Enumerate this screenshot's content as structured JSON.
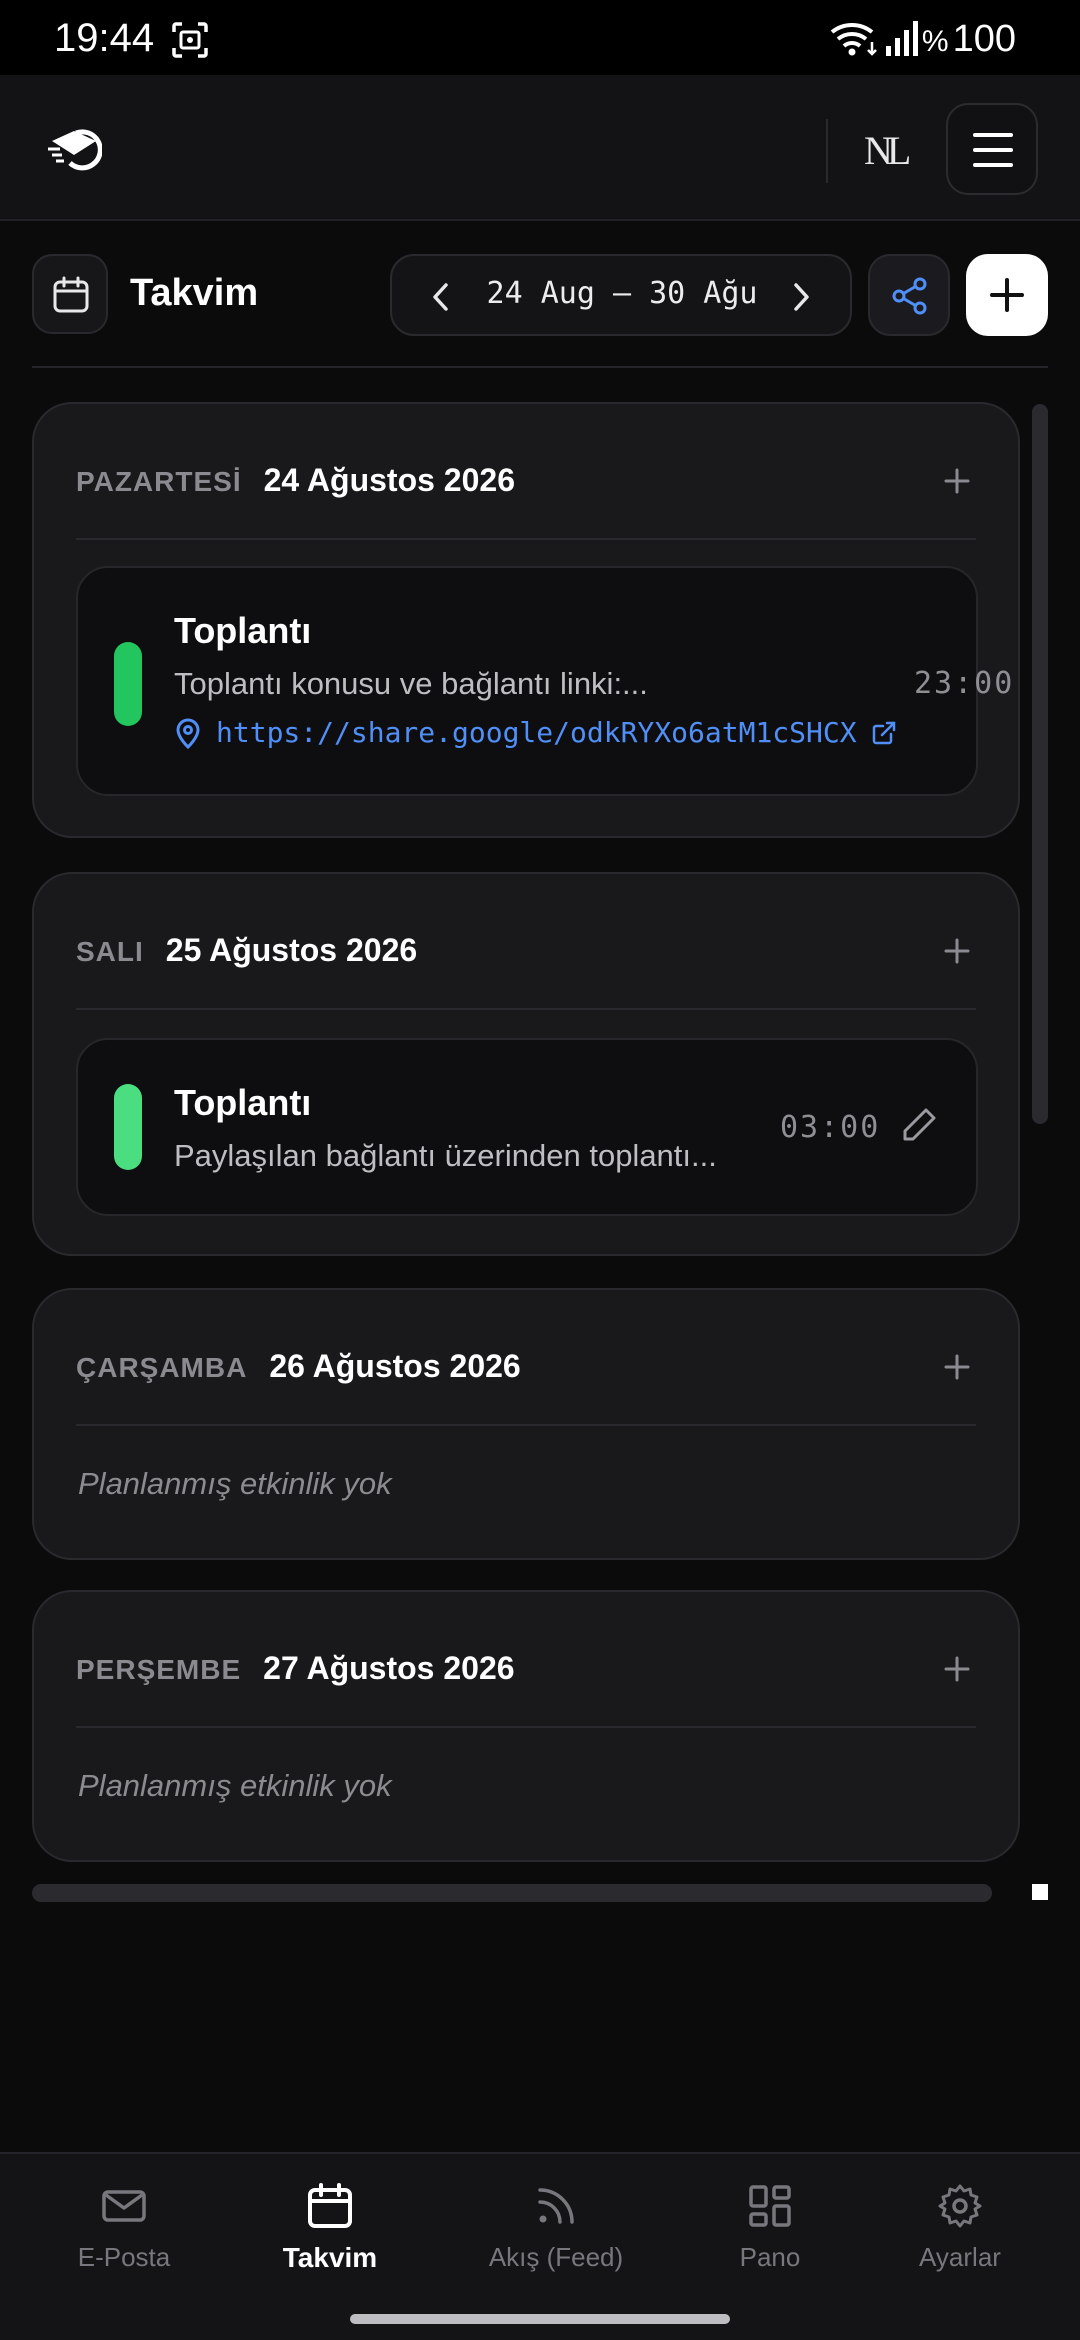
{
  "status_bar": {
    "time": "19:44",
    "battery_symbol": "%",
    "battery_value": "100"
  },
  "header": {
    "brand_mark": "NL"
  },
  "toolbar": {
    "title": "Takvim",
    "week_range": "24 Aug – 30 Ağu"
  },
  "days": [
    {
      "name": "PAZARTESİ",
      "date": "24 Ağustos 2026",
      "events": [
        {
          "title": "Toplantı",
          "description": "Toplantı konusu ve bağlantı linki:...",
          "link": "https://share.google/odkRYXo6atM1cSHCX",
          "time": "23:00",
          "color": "#22c55e"
        }
      ]
    },
    {
      "name": "SALI",
      "date": "25 Ağustos 2026",
      "events": [
        {
          "title": "Toplantı",
          "description": "Paylaşılan bağlantı üzerinden toplantı...",
          "time": "03:00",
          "color": "#4ade80"
        }
      ]
    },
    {
      "name": "ÇARŞAMBA",
      "date": "26 Ağustos 2026",
      "empty_text": "Planlanmış etkinlik yok"
    },
    {
      "name": "PERŞEMBE",
      "date": "27 Ağustos 2026",
      "empty_text": "Planlanmış etkinlik yok"
    }
  ],
  "bottom_nav": [
    {
      "label": "E-Posta",
      "icon": "mail-icon"
    },
    {
      "label": "Takvim",
      "icon": "calendar-icon",
      "active": true
    },
    {
      "label": "Akış (Feed)",
      "icon": "rss-icon"
    },
    {
      "label": "Pano",
      "icon": "grid-icon"
    },
    {
      "label": "Ayarlar",
      "icon": "gear-icon"
    }
  ],
  "colors": {
    "accent": "#4f8ff7",
    "background": "#0b0b0c",
    "card": "#19191b"
  }
}
